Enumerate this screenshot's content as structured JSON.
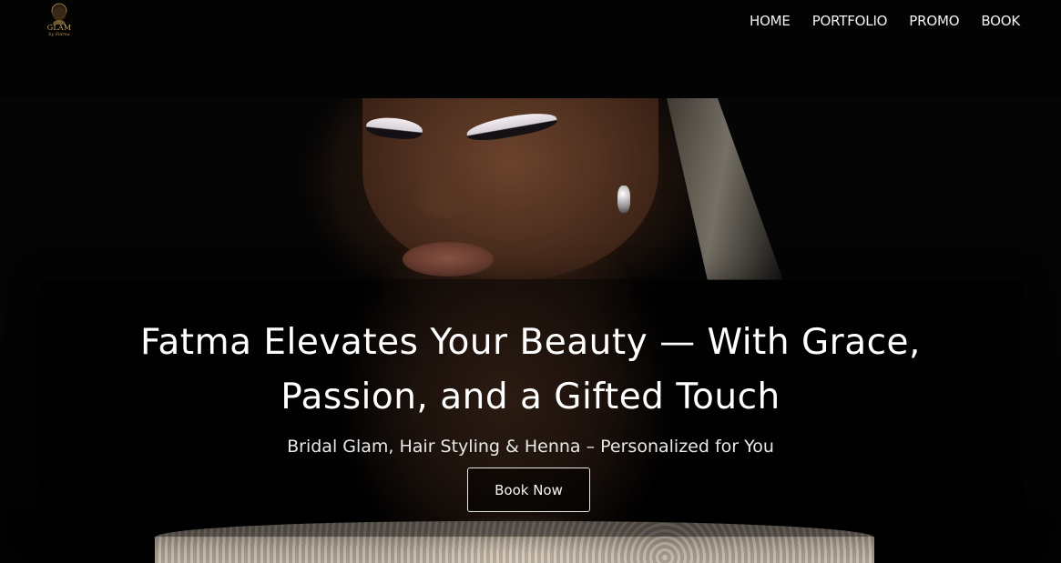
{
  "brand": {
    "logo_line1": "GLAM",
    "logo_line2": "by Fatma",
    "accent_color": "#c9a45e"
  },
  "nav": {
    "items": [
      {
        "label": "HOME"
      },
      {
        "label": "PORTFOLIO"
      },
      {
        "label": "PROMO"
      },
      {
        "label": "BOOK"
      }
    ]
  },
  "hero": {
    "headline_line1": "Fatma Elevates Your Beauty — With Grace,",
    "headline_line2": "Passion, and a Gifted Touch",
    "subheadline": "Bridal Glam, Hair Styling & Henna – Personalized for You",
    "cta_label": "Book Now"
  }
}
